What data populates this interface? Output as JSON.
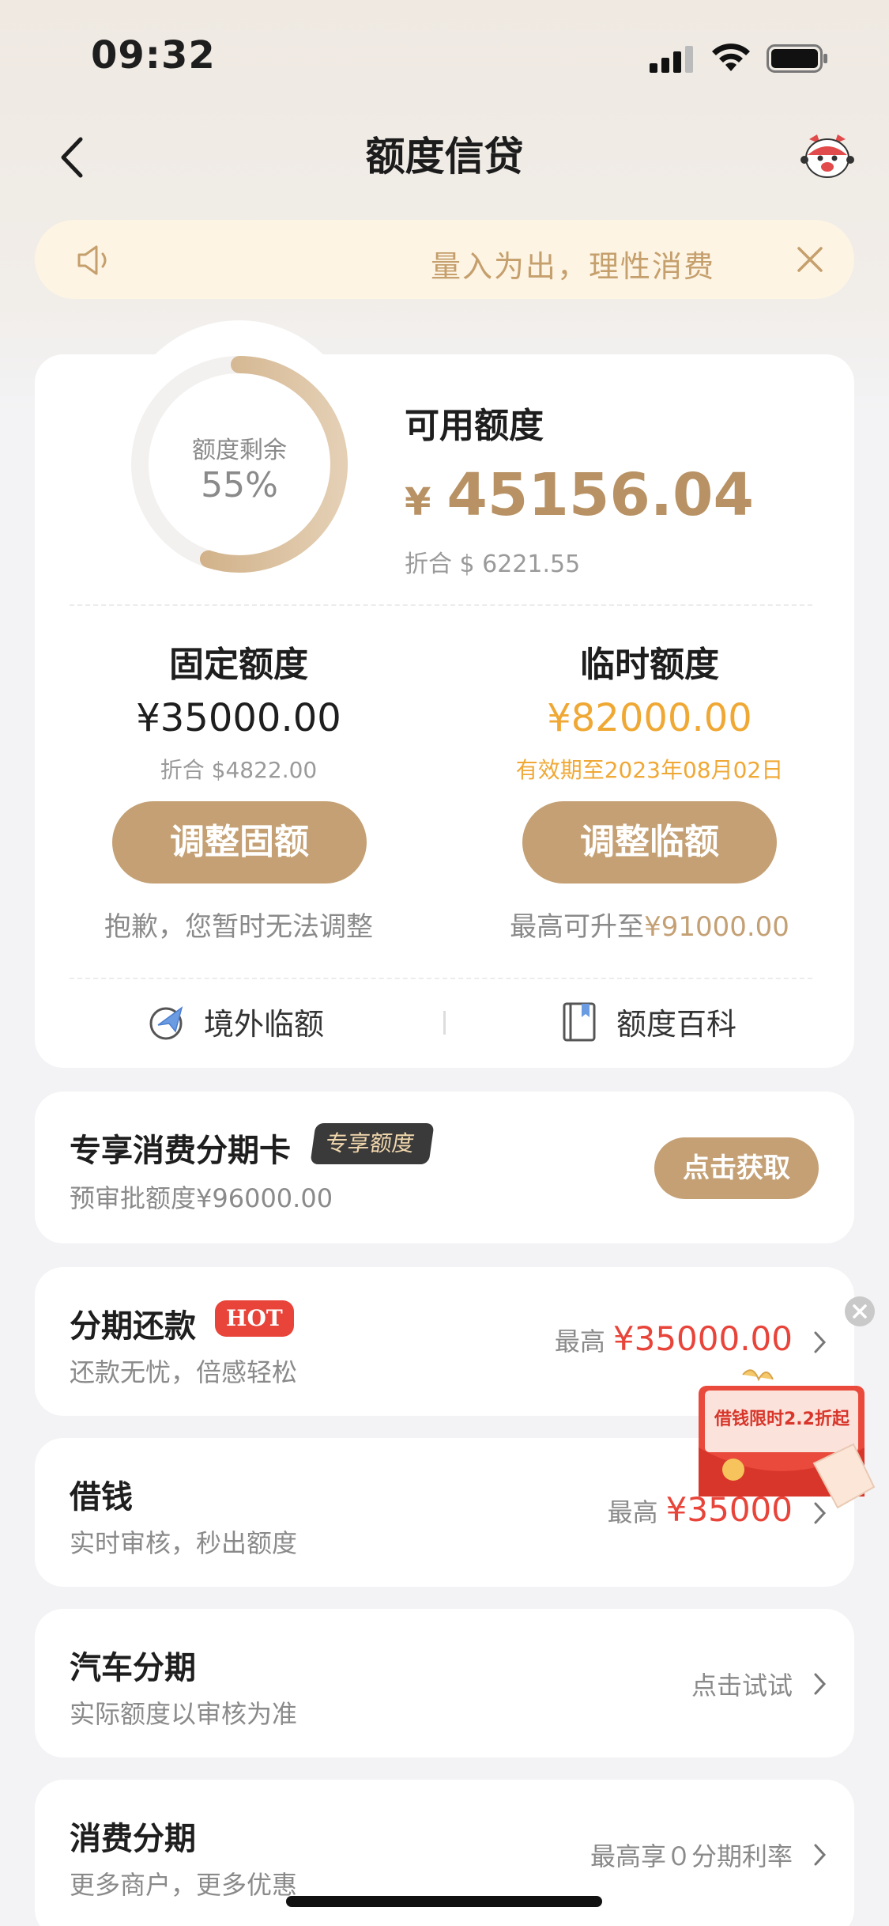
{
  "status_bar": {
    "time": "09:32"
  },
  "nav": {
    "title": "额度信贷"
  },
  "notice": {
    "text": "量入为出，理性消费"
  },
  "quota": {
    "ring_label": "额度剩余",
    "ring_percent": "55%",
    "ring_fraction": 0.55,
    "available_label": "可用额度",
    "currency_symbol": "¥",
    "available_amount": "45156.04",
    "available_usd": "折合 $ 6221.55",
    "fixed": {
      "title": "固定额度",
      "amount": "¥35000.00",
      "usd": "折合 $4822.00",
      "button": "调整固额",
      "note": "抱歉，您暂时无法调整"
    },
    "temporary": {
      "title": "临时额度",
      "amount": "¥82000.00",
      "validity": "有效期至2023年08月02日",
      "button": "调整临额",
      "note_prefix": "最高可升至",
      "note_value": "¥91000.00"
    },
    "links": {
      "overseas": "境外临额",
      "encyclopedia": "额度百科"
    }
  },
  "exclusive_card": {
    "title": "专享消费分期卡",
    "badge": "专享额度",
    "subtitle": "预审批额度¥96000.00",
    "button": "点击获取"
  },
  "rows": [
    {
      "title": "分期还款",
      "badge": "HOT",
      "subtitle": "还款无忧，倍感轻松",
      "right_prefix": "最高",
      "right_value": "¥35000.00"
    },
    {
      "title": "借钱",
      "subtitle": "实时审核，秒出额度",
      "right_prefix": "最高",
      "right_value": "¥35000"
    },
    {
      "title": "汽车分期",
      "subtitle": "实际额度以审核为准",
      "right_text": "点击试试"
    },
    {
      "title": "消费分期",
      "subtitle": "更多商户，更多优惠",
      "right_text": "最高享０分期利率"
    }
  ],
  "promo": {
    "text": "借钱限时2.2折起"
  },
  "colors": {
    "accent_gold": "#c4a074",
    "amount_gold": "#b89264",
    "temp_orange": "#f0a835",
    "price_red": "#e8443a",
    "notice_bg": "#fdf4e4"
  }
}
